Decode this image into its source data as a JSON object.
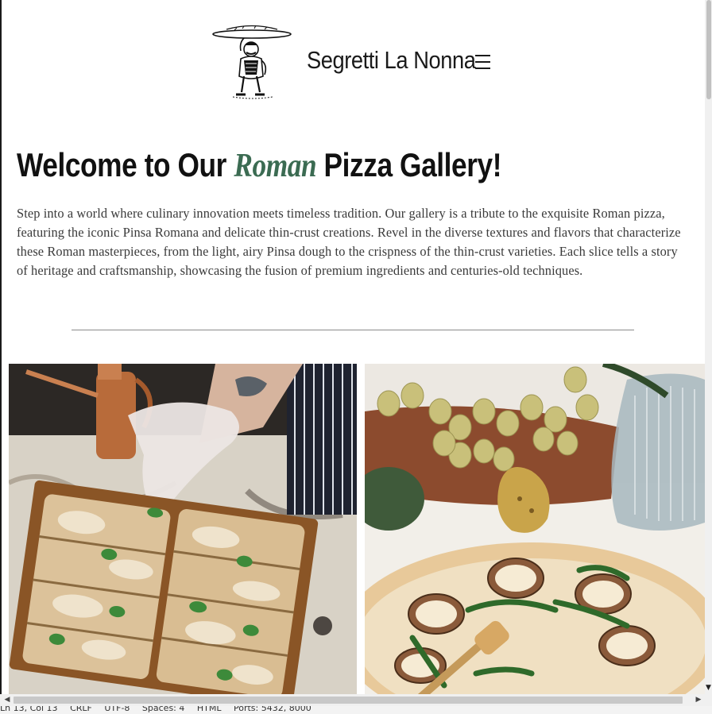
{
  "header": {
    "site_title": "Segretti La Nonna",
    "menu_icon": "hamburger-menu-icon",
    "logo": "chef-carrying-pizza-logo"
  },
  "hero": {
    "title_before": "Welcome to Our ",
    "title_highlight": "Roman",
    "title_after": " Pizza Gallery!",
    "highlight_color": "#3b6b52",
    "intro": "Step into a world where culinary innovation meets timeless tradition. Our gallery is a tribute to the exquisite Roman pizza, featuring the iconic Pinsa Romana and delicate thin-crust creations. Revel in the diverse textures and flavors that characterize these Roman masterpieces, from the light, airy Pinsa dough to the crispness of the thin-crust varieties. Each slice tells a story of heritage and craftsmanship, showcasing the fusion of premium ingredients and centuries-old techniques."
  },
  "gallery": {
    "images": [
      "pinsa-on-wooden-board-photo",
      "pear-thin-crust-pizza-photo"
    ]
  },
  "statusbar": {
    "items": [
      "Ln 13, Col 13",
      "CRLF",
      "UTF-8",
      "Spaces: 4",
      "HTML",
      "Ports: 5432, 8000"
    ]
  }
}
